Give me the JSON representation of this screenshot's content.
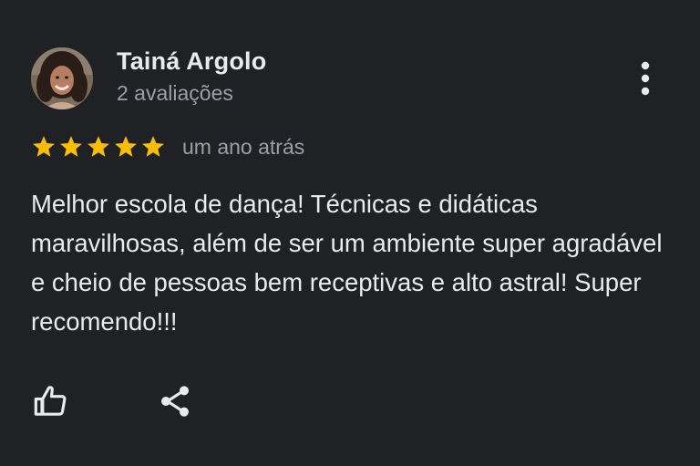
{
  "review": {
    "author_name": "Tainá Argolo",
    "author_reviews": "2 avaliações",
    "rating": 5,
    "rating_max": 5,
    "time_ago": "um ano atrás",
    "text": "Melhor escola de dança! Técnicas e didáticas maravilhosas, além de ser um ambiente super agradável e cheio de pessoas bem receptivas e alto astral! Super recomendo!!!"
  },
  "icons": {
    "more": "more-vert-icon",
    "like": "thumb-up-icon",
    "share": "share-icon",
    "star": "star-icon"
  },
  "colors": {
    "background": "#202124",
    "star": "#fbbc04",
    "primary_text": "#e8eaed",
    "secondary_text": "#9aa0a6"
  }
}
